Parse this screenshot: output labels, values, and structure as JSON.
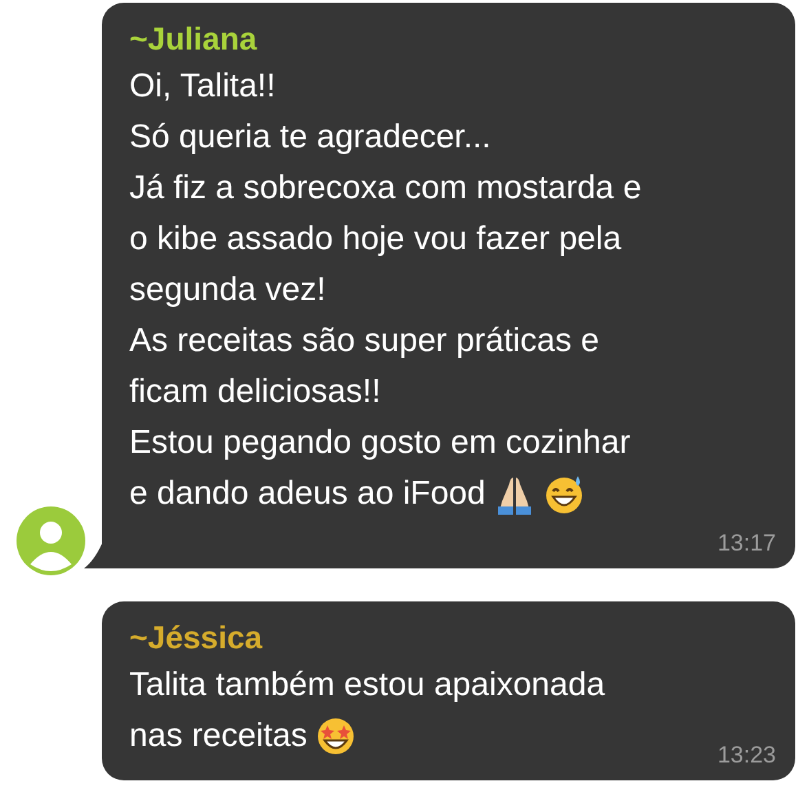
{
  "messages": [
    {
      "sender": "~Juliana",
      "color": "#a9d33b",
      "avatar": true,
      "lines": [
        "Oi, Talita!!",
        "Só queria te agradecer...",
        "Já fiz a sobrecoxa com mostarda e",
        "o kibe assado hoje vou fazer pela",
        "segunda vez!",
        "As receitas são super práticas e",
        "ficam deliciosas!!",
        "Estou pegando gosto em cozinhar",
        "e dando adeus ao iFood"
      ],
      "icons": [
        {
          "kind": "pray"
        },
        {
          "kind": "grin-sweat"
        }
      ],
      "time": "13:17"
    },
    {
      "sender": "~Jéssica",
      "color": "#d6ac2c",
      "avatar": false,
      "lines": [
        "Talita também estou apaixonada",
        "nas receitas "
      ],
      "icons": [
        {
          "kind": "star-struck"
        }
      ],
      "time": "13:23"
    }
  ]
}
